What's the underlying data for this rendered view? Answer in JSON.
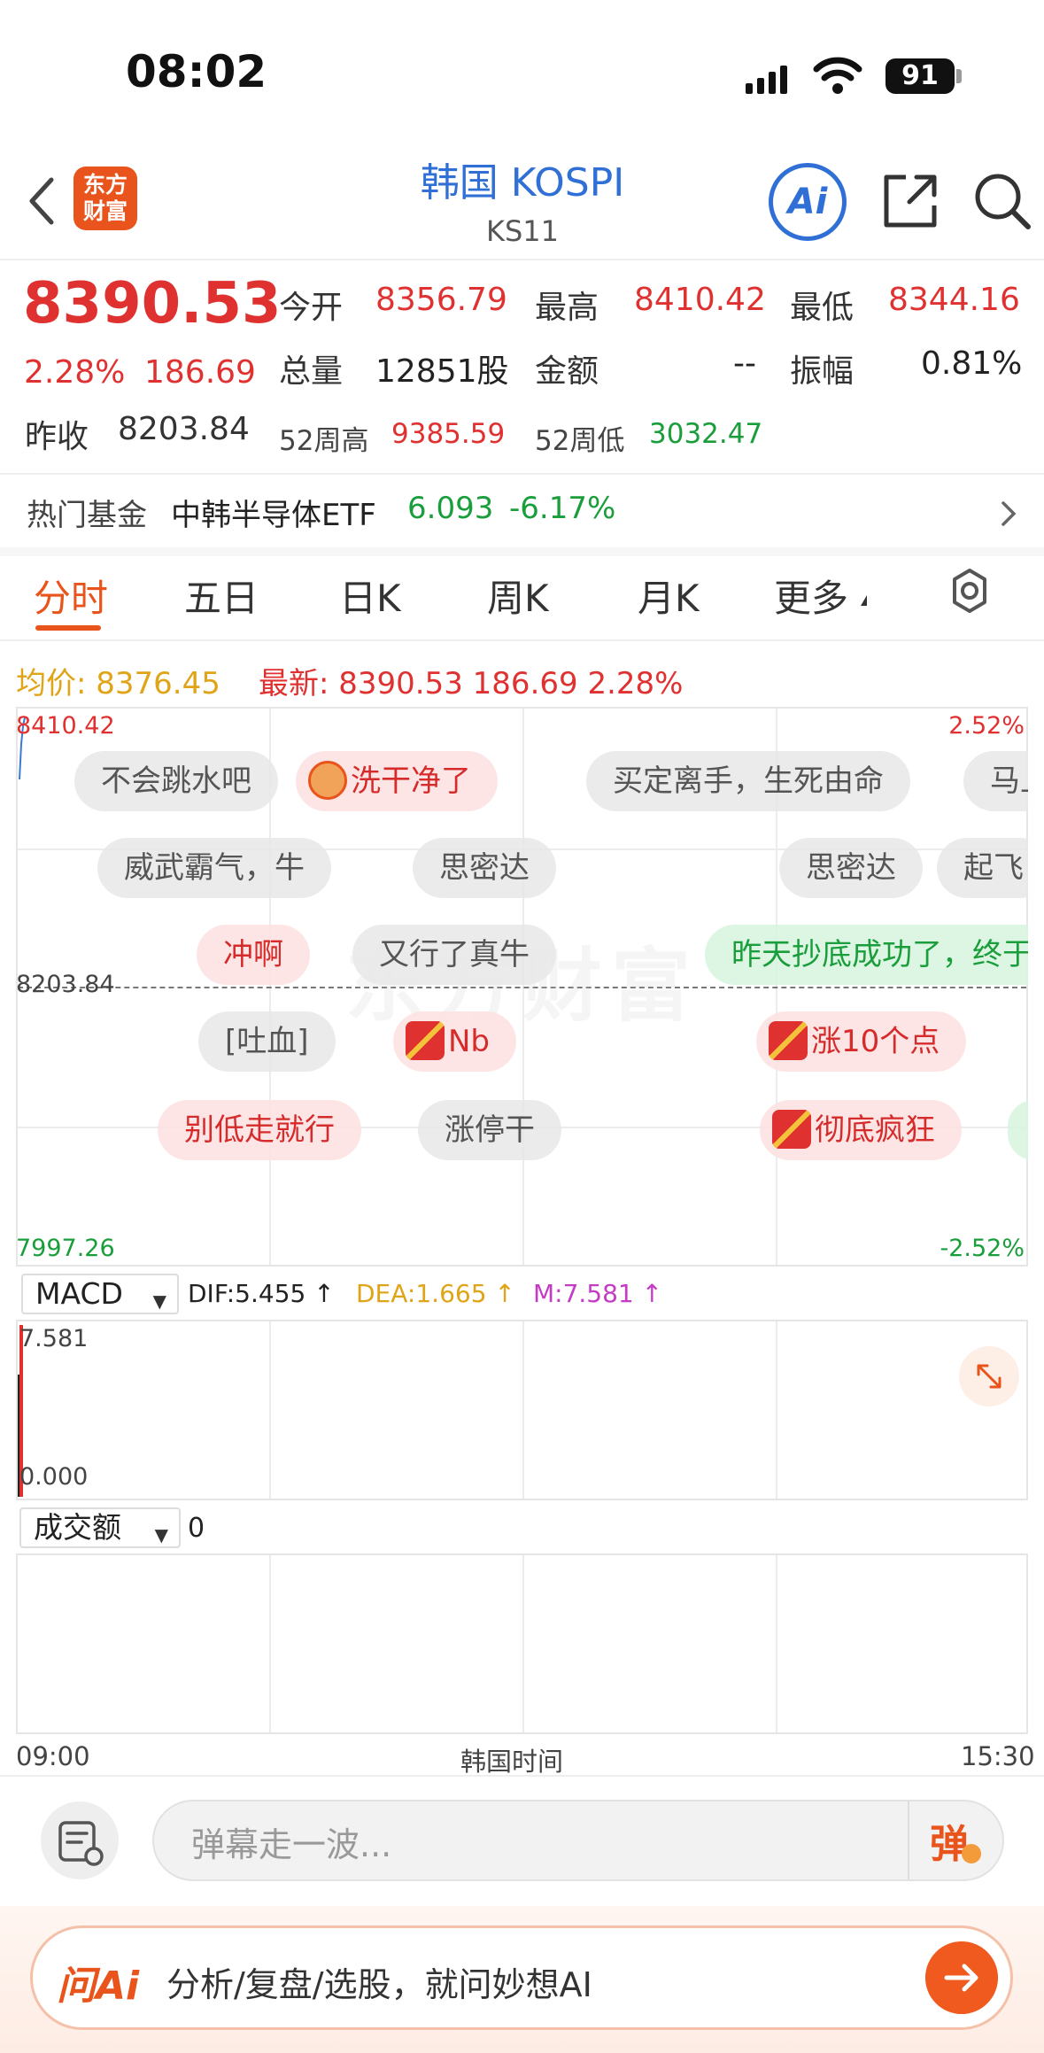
{
  "status": {
    "time": "08:02",
    "battery": "91"
  },
  "nav": {
    "title": "韩国 KOSPI",
    "code": "KS11",
    "logo_line1": "东方",
    "logo_line2": "财富",
    "ai_label": "Ai"
  },
  "quote": {
    "price": "8390.53",
    "change_pct": "2.28%",
    "change_val": "186.69",
    "prev_close_label": "昨收",
    "prev_close": "8203.84",
    "open_label": "今开",
    "open": "8356.79",
    "high_label": "最高",
    "high": "8410.42",
    "low_label": "最低",
    "low": "8344.16",
    "volume_label": "总量",
    "volume": "12851股",
    "amount_label": "金额",
    "amount": "--",
    "amplitude_label": "振幅",
    "amplitude": "0.81%",
    "w52_high_label": "52周高",
    "w52_high": "9385.59",
    "w52_low_label": "52周低",
    "w52_low": "3032.47"
  },
  "fund": {
    "label": "热门基金",
    "name": "中韩半导体ETF",
    "price": "6.093",
    "pct": "-6.17%"
  },
  "tabs": [
    "分时",
    "五日",
    "日K",
    "周K",
    "月K",
    "更多"
  ],
  "chart_header": {
    "avg_label": "均价: 8376.45",
    "latest_label": "最新: 8390.53  186.69  2.28%"
  },
  "chart_axis": {
    "top": "8410.42",
    "top_pct": "2.52%",
    "mid": "8203.84",
    "bottom": "7997.26",
    "bottom_pct": "-2.52%"
  },
  "danmu": [
    "不会跳水吧",
    "洗干净了",
    "买定离手，生死由命",
    "马上",
    "威武霸气，牛",
    "思密达",
    "思密达",
    "起飞",
    "冲啊",
    "又行了真牛",
    "昨天抄底成功了，终于",
    "[吐血]",
    "Nb",
    "涨10个点",
    "别低走就行",
    "涨停干",
    "彻底疯狂"
  ],
  "watermark": "东方财富",
  "macd": {
    "select": "MACD",
    "dif": "DIF:5.455 ↑",
    "dea": "DEA:1.665 ↑",
    "m": "M:7.581 ↑",
    "top": "7.581",
    "bottom": "0.000"
  },
  "volume": {
    "select": "成交额",
    "value": "0"
  },
  "time_axis": {
    "start": "09:00",
    "zone": "韩国时间",
    "end": "15:30"
  },
  "danmu_input": {
    "placeholder": "弹幕走一波...",
    "toggle": "弹"
  },
  "ai_bar": {
    "logo": "问Ai",
    "prompt": "分析/复盘/选股，就问妙想AI"
  },
  "colors": {
    "up": "#e03131",
    "down": "#1a9e3b",
    "accent": "#e8541b",
    "link": "#2f6fd6"
  }
}
